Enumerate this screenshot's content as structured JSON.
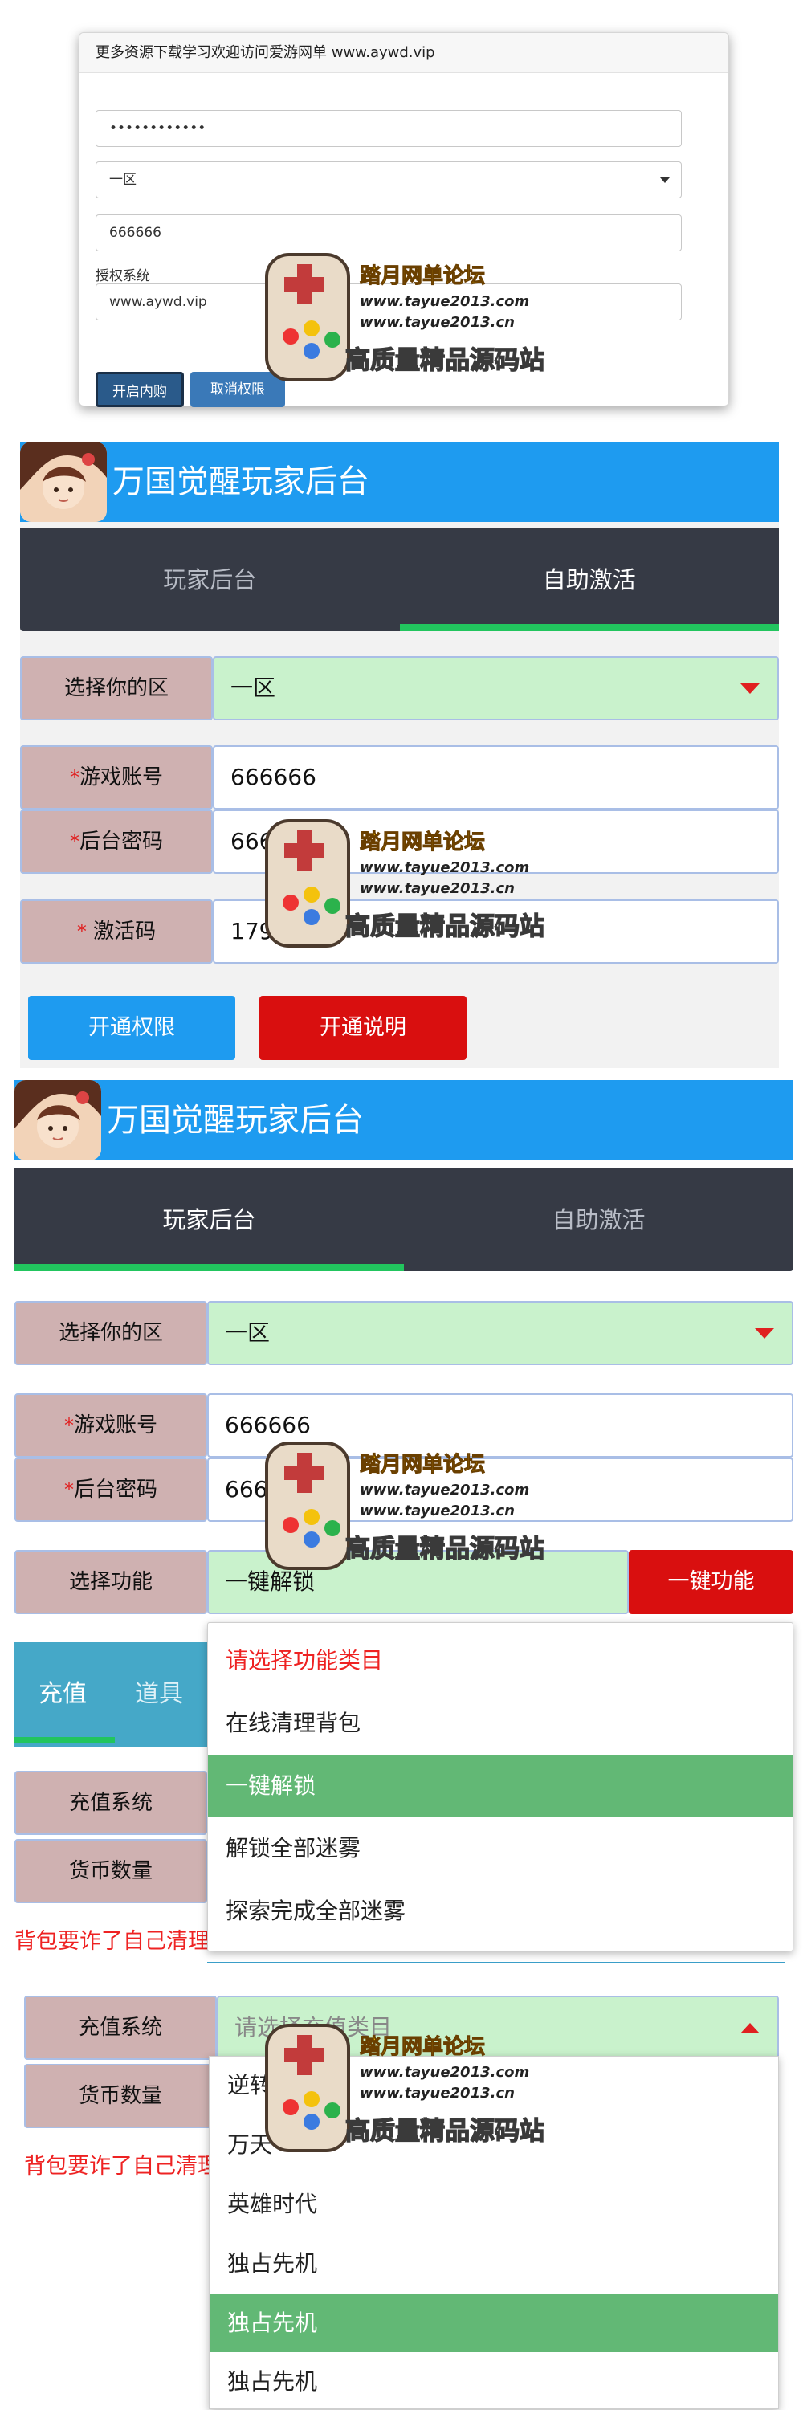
{
  "login_card": {
    "header": "更多资源下载学习欢迎访问爱游网单 www.aywd.vip",
    "password_mask": "••••••••••••",
    "server_select": "一区",
    "account_value": "666666",
    "auth_label": "授权系统",
    "auth_value": "www.aywd.vip",
    "btn_open_purchase": "开启内购",
    "btn_cancel_auth": "取消权限"
  },
  "panel_activate": {
    "title": "万国觉醒玩家后台",
    "tabs": [
      "玩家后台",
      "自助激活"
    ],
    "active_tab": "自助激活",
    "server_label": "选择你的区",
    "server_value": "一区",
    "account_label": "游戏账号",
    "account_value": "666666",
    "password_label": "后台密码",
    "password_value": "666",
    "code_label": "激活码",
    "code_value": "179     6",
    "required_star": "*",
    "btn_open": "开通权限",
    "btn_info": "开通说明"
  },
  "panel_player": {
    "title": "万国觉醒玩家后台",
    "tabs": [
      "玩家后台",
      "自助激活"
    ],
    "active_tab": "玩家后台",
    "server_label": "选择你的区",
    "server_value": "一区",
    "account_label": "游戏账号",
    "account_value": "666666",
    "password_label": "后台密码",
    "password_value": "666",
    "function_label": "选择功能",
    "function_value": "一键解锁",
    "btn_function": "一键功能",
    "subtabs": [
      "充值",
      "道具"
    ],
    "recharge_label": "充值系统",
    "currency_label": "货币数量",
    "warning": "背包要诈了自己清理背包",
    "dropdown": [
      "请选择功能类目",
      "在线清理背包",
      "一键解锁",
      "解锁全部迷雾",
      "探索完成全部迷雾"
    ],
    "dropdown_selected": "一键解锁"
  },
  "panel_recharge": {
    "recharge_label": "充值系统",
    "recharge_placeholder": "请选择充值类目",
    "currency_label": "货币数量",
    "warning": "背包要诈了自己清理背包",
    "dropdown": [
      "逆转",
      "万天",
      "英雄时代",
      "独占先机",
      "独占先机",
      "独占先机"
    ],
    "dropdown_selected_index": 4
  },
  "watermark": {
    "title": "踏月网单论坛",
    "url1": "www.tayue2013.com",
    "url2": "www.tayue2013.cn",
    "slogan": "高质量精品源码站"
  },
  "colors": {
    "header_blue": "#1e9bf0",
    "tab_dark": "#363a45",
    "active_green": "#22c55e",
    "select_green": "#c9f2cc",
    "label_pink": "#cfb1b1",
    "danger_red": "#d90f0f",
    "dropdown_selected": "#62b875"
  }
}
